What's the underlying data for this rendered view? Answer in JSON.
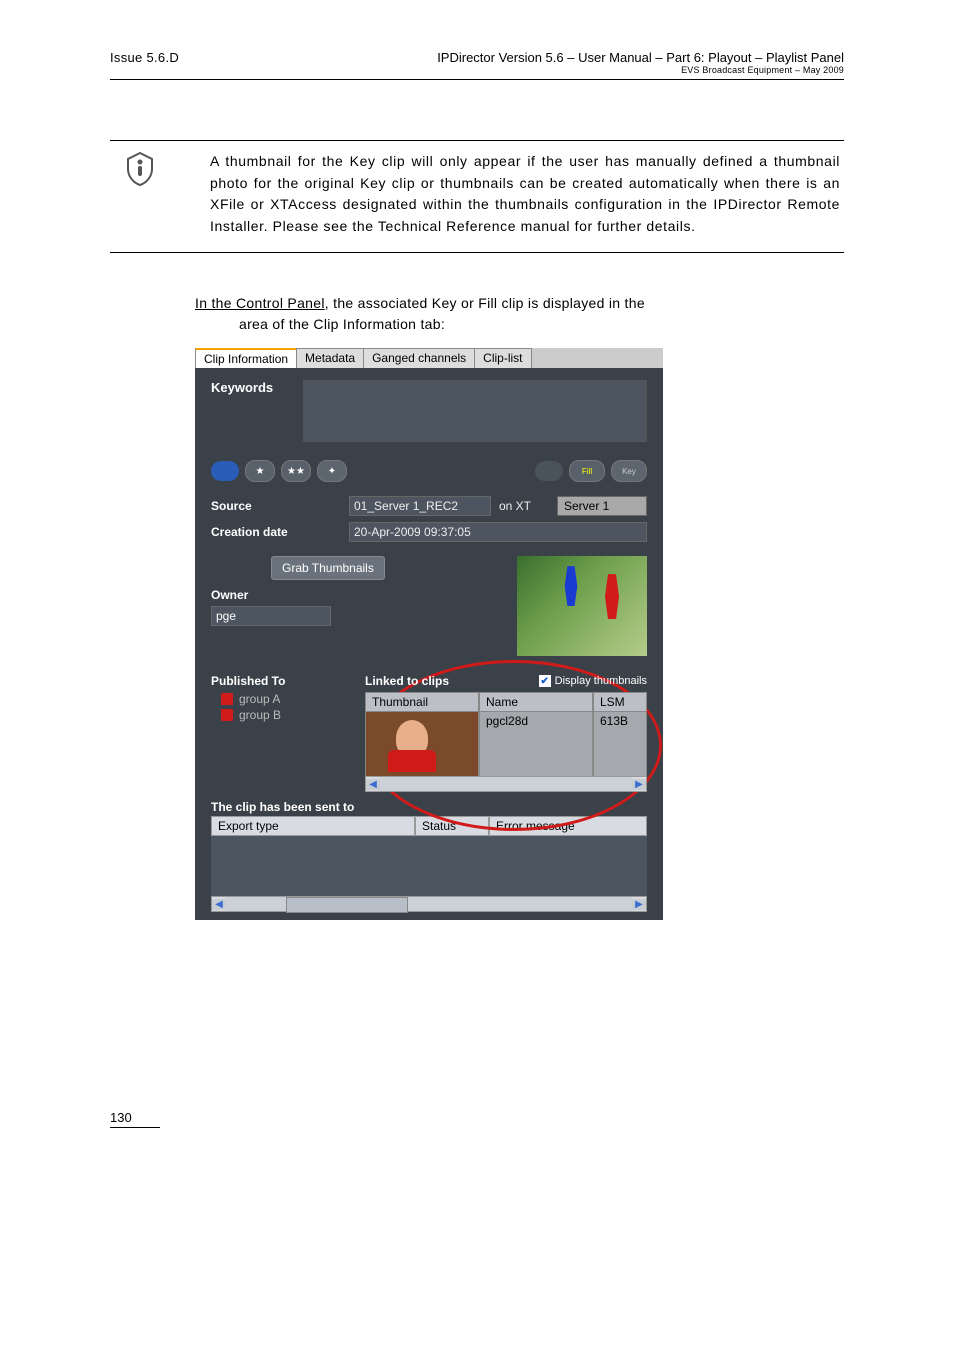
{
  "header": {
    "issue": "Issue 5.6.D",
    "title": "IPDirector Version 5.6 – User Manual – Part 6: Playout – Playlist Panel",
    "sub": "EVS Broadcast Equipment – May 2009"
  },
  "note": "A thumbnail for the Key clip will only appear if the user has manually defined a thumbnail photo for the original Key clip or thumbnails can be created automatically when there is an XFile or XTAccess designated within the thumbnails configuration in the IPDirector Remote Installer. Please see the Technical Reference manual for further details.",
  "body": {
    "lead_underlined": "In the Control Panel",
    "lead_rest": ", the associated Key or Fill clip is displayed in the",
    "indent_line": "area of the Clip Information tab:"
  },
  "tabs": [
    "Clip Information",
    "Metadata",
    "Ganged channels",
    "Clip-list"
  ],
  "panel": {
    "keywords_label": "Keywords",
    "fill_label": "Fill",
    "key_label": "Key",
    "source_label": "Source",
    "source_value": "01_Server 1_REC2",
    "onxt": "on XT",
    "server_button": "Server 1",
    "creation_label": "Creation date",
    "creation_value": "20-Apr-2009 09:37:05",
    "grab_button": "Grab Thumbnails",
    "owner_label": "Owner",
    "owner_value": "pge",
    "published_label": "Published To",
    "groups": [
      "group A",
      "group B"
    ],
    "linked_label": "Linked to clips",
    "display_thumbs_label": "Display thumbnails",
    "linked_columns": {
      "thumb": "Thumbnail",
      "name": "Name",
      "lsm": "LSM"
    },
    "linked_row": {
      "name": "pgcl28d",
      "lsm": "613B"
    },
    "sent_label": "The clip has been sent to",
    "sent_columns": {
      "export_type": "Export type",
      "status": "Status",
      "error": "Error message"
    }
  },
  "page_number": "130"
}
